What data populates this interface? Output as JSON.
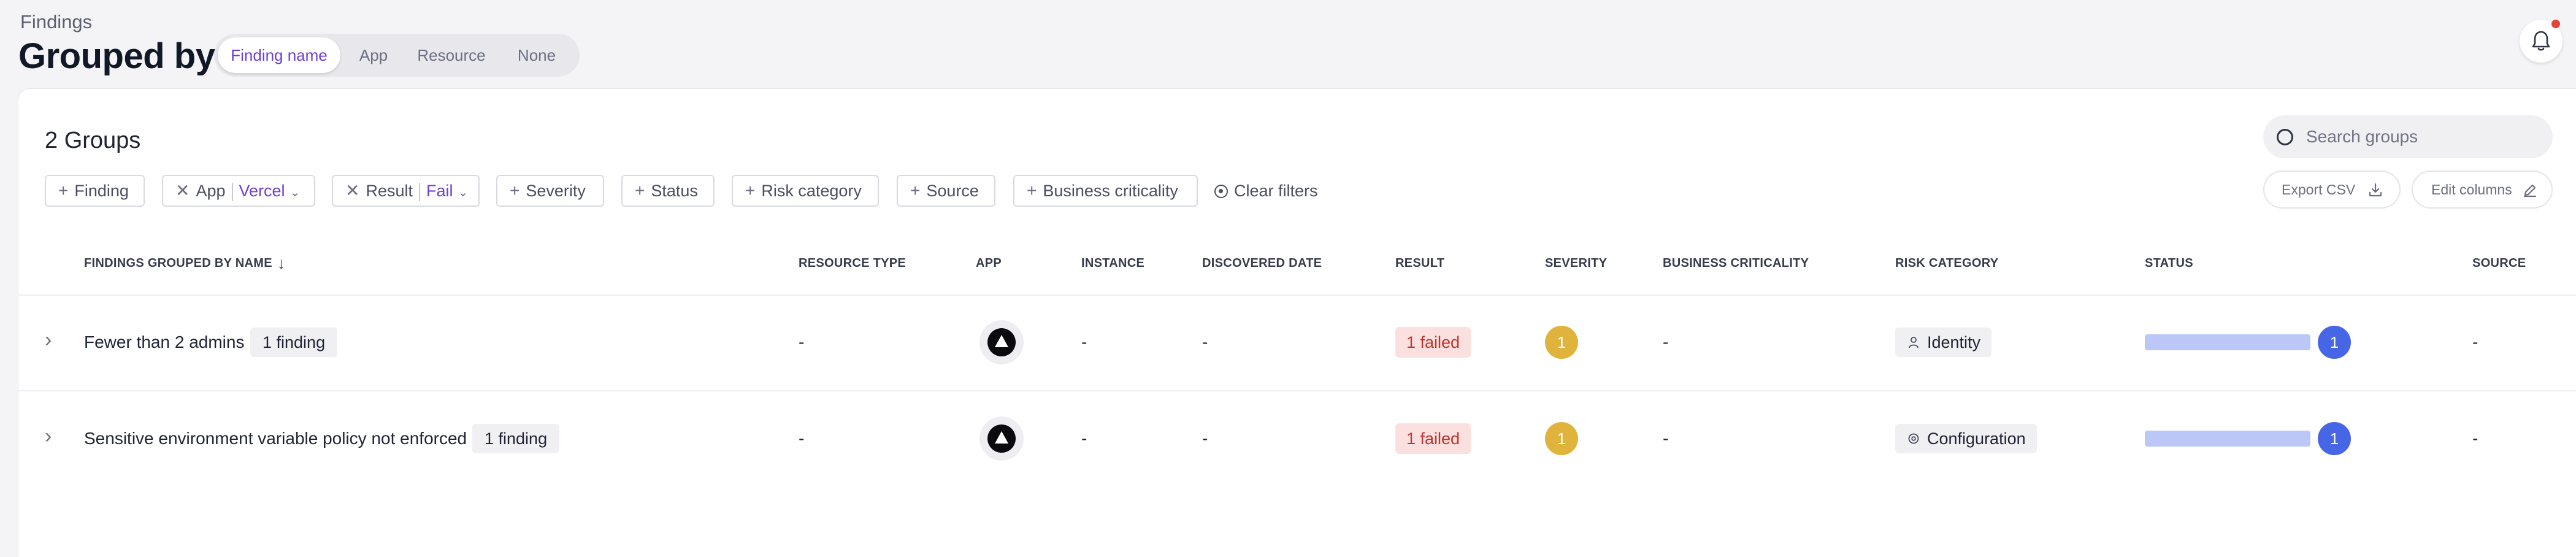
{
  "header": {
    "breadcrumb": "Findings",
    "title": "Grouped by",
    "group_options": [
      "Finding name",
      "App",
      "Resource",
      "None"
    ],
    "active_group": "Finding name"
  },
  "summary": {
    "groups_count": "2 Groups"
  },
  "search": {
    "placeholder": "Search groups",
    "icon": "search-icon"
  },
  "filters": {
    "add_finding": "Finding",
    "app_label": "App",
    "app_value": "Vercel",
    "result_label": "Result",
    "result_value": "Fail",
    "add_severity": "Severity",
    "add_status": "Status",
    "add_risk_category": "Risk category",
    "add_source": "Source",
    "add_business_criticality": "Business criticality",
    "clear": "Clear filters"
  },
  "actions": {
    "export_csv": "Export CSV",
    "edit_columns": "Edit columns"
  },
  "table": {
    "columns": [
      "FINDINGS GROUPED BY NAME",
      "RESOURCE TYPE",
      "APP",
      "INSTANCE",
      "DISCOVERED DATE",
      "RESULT",
      "SEVERITY",
      "BUSINESS CRITICALITY",
      "RISK CATEGORY",
      "STATUS",
      "SOURCE"
    ],
    "sort": {
      "column": "FINDINGS GROUPED BY NAME",
      "direction": "descending"
    },
    "rows": [
      {
        "name": "Fewer than 2 admins",
        "count": "1 finding",
        "resource_type": "-",
        "app": "Vercel",
        "app_icon": "vercel-logo-icon",
        "instance": "-",
        "discovered_date": "-",
        "result": "1 failed",
        "severity": "1",
        "business_criticality": "-",
        "risk_category": "Identity",
        "risk_icon": "person-icon",
        "status_count": "1",
        "status_fill": 1.0,
        "source": "-"
      },
      {
        "name": "Sensitive environment variable policy not enforced",
        "count": "1 finding",
        "resource_type": "-",
        "app": "Vercel",
        "app_icon": "vercel-logo-icon",
        "instance": "-",
        "discovered_date": "-",
        "result": "1 failed",
        "severity": "1",
        "business_criticality": "-",
        "risk_category": "Configuration",
        "risk_icon": "gear-icon",
        "status_count": "1",
        "status_fill": 1.0,
        "source": "-"
      }
    ]
  },
  "colors": {
    "accent": "#6d3fd9",
    "severity": "#e0b43c",
    "failed_bg": "#fbe0df",
    "failed_text": "#c0352c",
    "status_bar": "#bac7f7",
    "status_badge": "#4766e6",
    "notification_dot": "#e0443a"
  }
}
